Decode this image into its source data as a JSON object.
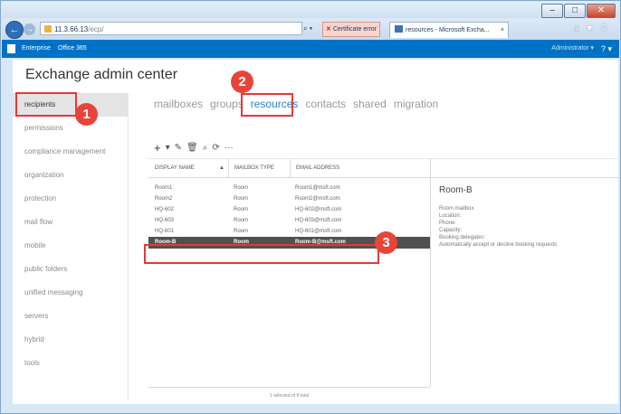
{
  "window": {
    "minimize": "–",
    "maximize": "□",
    "close": "✕"
  },
  "browser": {
    "back": "←",
    "forward": "→",
    "url_host": "11.3.66.13",
    "url_rest": "/ecp/",
    "search_tools": "⌕ ▾",
    "cert_error": "Certificate error",
    "tab_label": "resources - Microsoft Excha...",
    "tab_close": "×",
    "icons": [
      "home-icon",
      "star-icon",
      "gear-icon"
    ]
  },
  "o365": {
    "link1": "Enterprise",
    "link2": "Office 365",
    "admin": "Administrator ▾",
    "help": "? ▾"
  },
  "app": {
    "title": "Exchange admin center"
  },
  "nav": {
    "items": [
      "recipients",
      "permissions",
      "compliance management",
      "organization",
      "protection",
      "mail flow",
      "mobile",
      "public folders",
      "unified messaging",
      "servers",
      "hybrid",
      "tools"
    ],
    "selected_index": 0
  },
  "tabs": [
    "mailboxes",
    "groups",
    "resources",
    "contacts",
    "shared",
    "migration"
  ],
  "active_tab": "resources",
  "toolbar": {
    "add": "+",
    "add_menu": "▾",
    "edit": "✎",
    "delete": "🗑",
    "search": "⌕",
    "refresh": "⟳",
    "more": "···"
  },
  "table": {
    "headers": {
      "display_name": "DISPLAY NAME",
      "sort": "▲",
      "mailbox_type": "MAILBOX TYPE",
      "email": "EMAIL ADDRESS"
    },
    "rows": [
      {
        "name": "Room1",
        "type": "Room",
        "email": "Room1@msft.com"
      },
      {
        "name": "Room2",
        "type": "Room",
        "email": "Room2@msft.com"
      },
      {
        "name": "HQ-602",
        "type": "Room",
        "email": "HQ-602@msft.com"
      },
      {
        "name": "HQ-603",
        "type": "Room",
        "email": "HQ-603@msft.com"
      },
      {
        "name": "HQ-601",
        "type": "Room",
        "email": "HQ-601@msft.com"
      },
      {
        "name": "Room-B",
        "type": "Room",
        "email": "Room-B@msft.com"
      }
    ],
    "selected_index": 5,
    "footer": "1 selected of 6 total"
  },
  "details": {
    "title": "Room-B",
    "lines": [
      "Room mailbox",
      "Location:",
      "Phone:",
      "Capacity:",
      "Booking delegates:",
      "Automatically accept or decline booking requests"
    ]
  },
  "callouts": [
    "1",
    "2",
    "3"
  ],
  "colors": {
    "accent": "#0072c6",
    "callout": "#e53935",
    "active_tab": "#2a7fce",
    "selected_row": "#505050"
  }
}
